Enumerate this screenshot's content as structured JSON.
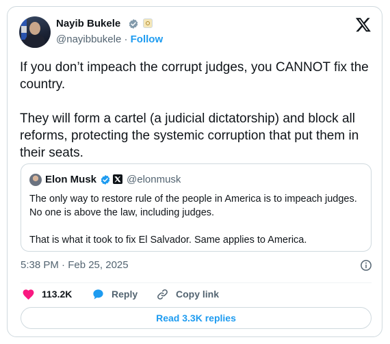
{
  "author": {
    "name": "Nayib Bukele",
    "handle": "@nayibbukele",
    "separator": "·",
    "follow_label": "Follow"
  },
  "tweet": {
    "text": "If you don’t impeach the corrupt judges, you CANNOT fix the country.\n\nThey will form a cartel (a judicial dictatorship) and block all reforms, protecting the systemic corruption that put them in their seats.",
    "timestamp": "5:38 PM · Feb 25, 2025"
  },
  "quoted": {
    "name": "Elon Musk",
    "handle": "@elonmusk",
    "text": "The only way to restore rule of the people in America is to impeach judges. No one is above the law, including judges.\n\nThat is what it took to fix El Salvador. Same applies to America."
  },
  "actions": {
    "likes": "113.2K",
    "reply_label": "Reply",
    "copy_label": "Copy link"
  },
  "replies_button": "Read 3.3K replies",
  "icons": [
    "x-logo-icon",
    "verified-badge-icon",
    "government-badge-icon",
    "info-icon",
    "heart-icon",
    "reply-bubble-icon",
    "link-icon"
  ],
  "colors": {
    "accent": "#1d9bf0",
    "like": "#f91880",
    "muted": "#536471",
    "border": "#cfd9de"
  }
}
